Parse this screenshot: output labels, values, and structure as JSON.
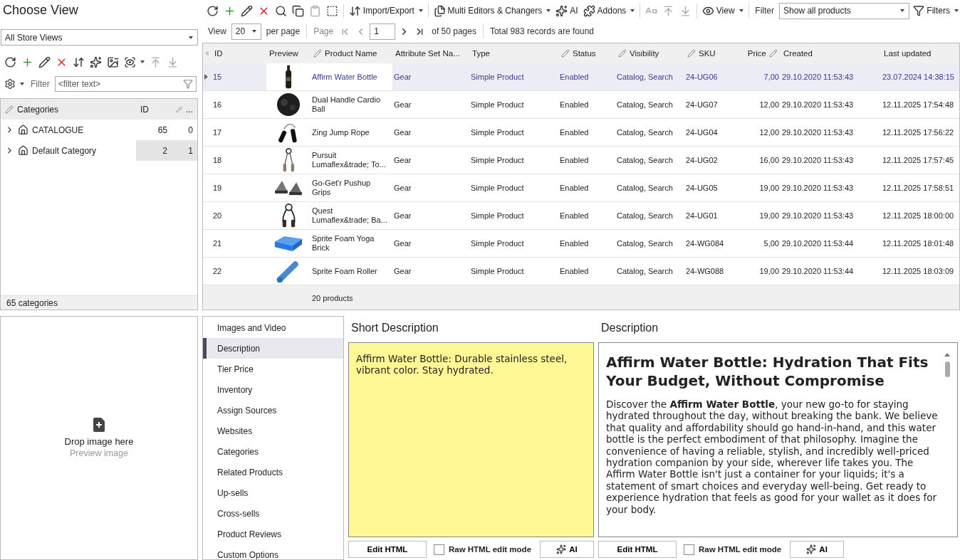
{
  "left_panel": {
    "title": "Choose View",
    "store_view": "All Store Views",
    "toolbar": [
      {
        "disabled": false
      },
      {
        "disabled": false
      },
      {
        "disabled": false
      },
      {
        "disabled": false
      },
      {
        "disabled": false
      },
      {
        "disabled": false
      },
      {
        "disabled": false
      },
      {
        "disabled": false,
        "menu": true
      },
      {
        "disabled": true
      },
      {
        "disabled": true
      }
    ],
    "filter": {
      "label": "Filter",
      "placeholder": "<filter text>"
    },
    "categories": {
      "columns": [
        "Categories",
        "ID",
        "..."
      ],
      "rows": [
        {
          "name": "CATALOGUE",
          "id": "65",
          "count": "0",
          "expanded": false,
          "selected": false
        },
        {
          "name": "Default Category",
          "id": "2",
          "count": "1",
          "expanded": false,
          "selected": true
        }
      ],
      "footer": "65 categories"
    }
  },
  "main_toolbar": {
    "items": [
      {
        "kind": "button",
        "disabled": false
      },
      {
        "kind": "button",
        "disabled": false
      },
      {
        "kind": "button",
        "disabled": false
      },
      {
        "kind": "button",
        "disabled": false
      },
      {
        "kind": "button",
        "disabled": false
      },
      {
        "kind": "button",
        "disabled": false
      },
      {
        "kind": "button",
        "disabled": true
      },
      {
        "kind": "button",
        "disabled": false
      },
      {
        "kind": "separator"
      },
      {
        "kind": "button",
        "label": "Import/Export",
        "menu": true,
        "disabled": false
      },
      {
        "kind": "separator"
      },
      {
        "kind": "button",
        "label": "Multi Editors & Changers",
        "menu": true,
        "disabled": false
      },
      {
        "kind": "button",
        "label": "AI",
        "menu": false,
        "disabled": false
      },
      {
        "kind": "button",
        "label": "Addons",
        "menu": true,
        "disabled": false
      },
      {
        "kind": "separator"
      },
      {
        "kind": "button",
        "disabled": true
      },
      {
        "kind": "button",
        "disabled": true
      },
      {
        "kind": "button",
        "disabled": true
      },
      {
        "kind": "separator"
      },
      {
        "kind": "button",
        "label": "View",
        "menu": true,
        "disabled": false
      },
      {
        "kind": "separator"
      }
    ],
    "filter_label": "Filter",
    "filter_value": "Show all products",
    "filters": "Filters"
  },
  "pager": {
    "view_label": "View",
    "page_size": "20",
    "per_page": "per page",
    "page_label": "Page",
    "page": "1",
    "of_pages": "of 50 pages",
    "total": "Total 983 records are found"
  },
  "grid": {
    "columns": [
      {
        "label": "ID",
        "kind": "text",
        "editable": false
      },
      {
        "label": "Preview",
        "kind": "text",
        "editable": false
      },
      {
        "label": "Product Name",
        "kind": "text",
        "editable": true
      },
      {
        "label": "Attribute Set Na...",
        "kind": "text",
        "editable": false
      },
      {
        "label": "Type",
        "kind": "text",
        "editable": false
      },
      {
        "label": "Status",
        "kind": "text",
        "editable": true
      },
      {
        "label": "Visibility",
        "kind": "text",
        "editable": true
      },
      {
        "label": "SKU",
        "kind": "text",
        "editable": true
      },
      {
        "label": "Price",
        "kind": "number",
        "editable": true
      },
      {
        "label": "Created",
        "kind": "text",
        "editable": false
      },
      {
        "label": "Last updated",
        "kind": "text",
        "editable": false
      }
    ],
    "rows": [
      {
        "id": "15",
        "name": "Affirm Water Bottle",
        "attribute_set": "Gear",
        "type": "Simple Product",
        "status": "Enabled",
        "visibility": "Catalog, Search",
        "sku": "24-UG06",
        "price": "7,00",
        "created": "29.10.2020 11:53:43",
        "updated": "23.07.2024 14:38:15",
        "selected": true
      },
      {
        "id": "16",
        "name": "Dual Handle Cardio Ball",
        "attribute_set": "Gear",
        "type": "Simple Product",
        "status": "Enabled",
        "visibility": "Catalog, Search",
        "sku": "24-UG07",
        "price": "12,00",
        "created": "29.10.2020 11:53:43",
        "updated": "12.11.2025 17:54:48",
        "selected": false
      },
      {
        "id": "17",
        "name": "Zing Jump Rope",
        "attribute_set": "Gear",
        "type": "Simple Product",
        "status": "Enabled",
        "visibility": "Catalog, Search",
        "sku": "24-UG04",
        "price": "12,00",
        "created": "29.10.2020 11:53:43",
        "updated": "12.11.2025 17:56:22",
        "selected": false
      },
      {
        "id": "18",
        "name": "Pursuit Lumaflex&trade; To...",
        "attribute_set": "Gear",
        "type": "Simple Product",
        "status": "Enabled",
        "visibility": "Catalog, Search",
        "sku": "24-UG02",
        "price": "16,00",
        "created": "29.10.2020 11:53:43",
        "updated": "12.11.2025 17:57:45",
        "selected": false
      },
      {
        "id": "19",
        "name": "Go-Get'r Pushup Grips",
        "attribute_set": "Gear",
        "type": "Simple Product",
        "status": "Enabled",
        "visibility": "Catalog, Search",
        "sku": "24-UG05",
        "price": "19,00",
        "created": "29.10.2020 11:53:43",
        "updated": "12.11.2025 17:58:51",
        "selected": false
      },
      {
        "id": "20",
        "name": "Quest Lumaflex&trade; Ba...",
        "attribute_set": "Gear",
        "type": "Simple Product",
        "status": "Enabled",
        "visibility": "Catalog, Search",
        "sku": "24-UG01",
        "price": "19,00",
        "created": "29.10.2020 11:53:43",
        "updated": "12.11.2025 18:00:00",
        "selected": false
      },
      {
        "id": "21",
        "name": "Sprite Foam Yoga Brick",
        "attribute_set": "Gear",
        "type": "Simple Product",
        "status": "Enabled",
        "visibility": "Catalog, Search",
        "sku": "24-WG084",
        "price": "5,00",
        "created": "29.10.2020 11:53:44",
        "updated": "12.11.2025 18:01:48",
        "selected": false
      },
      {
        "id": "22",
        "name": "Sprite Foam Roller",
        "attribute_set": "Gear",
        "type": "Simple Product",
        "status": "Enabled",
        "visibility": "Catalog, Search",
        "sku": "24-WG088",
        "price": "19,00",
        "created": "29.10.2020 11:53:44",
        "updated": "12.11.2025 18:03:09",
        "selected": false
      }
    ],
    "footer": "20 products"
  },
  "image_pane": {
    "drop_text": "Drop image here",
    "hint": "Preview image"
  },
  "detail_tabs": [
    {
      "label": "Images and Video",
      "selected": false
    },
    {
      "label": "Description",
      "selected": true
    },
    {
      "label": "Tier Price",
      "selected": false
    },
    {
      "label": "Inventory",
      "selected": false
    },
    {
      "label": "Assign Sources",
      "selected": false
    },
    {
      "label": "Websites",
      "selected": false
    },
    {
      "label": "Categories",
      "selected": false
    },
    {
      "label": "Related Products",
      "selected": false
    },
    {
      "label": "Up-sells",
      "selected": false
    },
    {
      "label": "Cross-sells",
      "selected": false
    },
    {
      "label": "Product Reviews",
      "selected": false
    },
    {
      "label": "Custom Options",
      "selected": false
    }
  ],
  "editors": [
    {
      "kind": "plain",
      "title": "Short Description",
      "text": "Affirm Water Bottle: Durable stainless steel, vibrant color. Stay hydrated.",
      "edit_html": "Edit HTML",
      "raw_mode": {
        "label": "Raw HTML edit mode",
        "checked": false
      },
      "ai": "AI"
    },
    {
      "kind": "rich",
      "title": "Description",
      "heading": "Affirm Water Bottle: Hydration That Fits Your Budget, Without Compromise",
      "text": "Discover the **Affirm Water Bottle**, your new go-to for staying hydrated throughout the day, without breaking the bank. We believe that quality and affordability should go hand-in-hand, and this water bottle is the perfect embodiment of that philosophy. Imagine the convenience of having a reliable, stylish, and incredibly well-priced hydration companion by your side, wherever life takes you. The Affirm Water Bottle isn't just a container for your liquids; it's a statement of smart choices and everyday well-being. Get ready to experience hydration that feels as good for your wallet as it does for your body.",
      "edit_html": "Edit HTML",
      "raw_mode": {
        "label": "Raw HTML edit mode",
        "checked": false
      },
      "ai": "AI"
    }
  ]
}
